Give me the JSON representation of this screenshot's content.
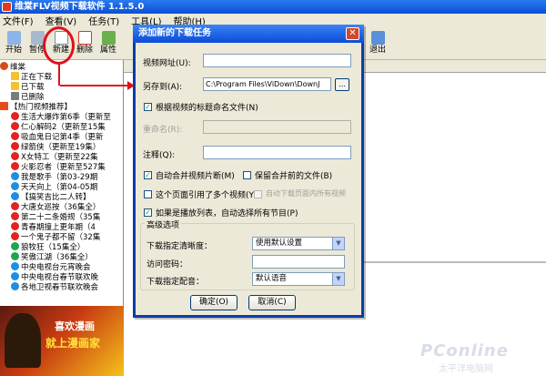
{
  "app": {
    "title": "维棠FLV视频下载软件 1.1.5.0",
    "menu": [
      "文件(F)",
      "查看(V)",
      "任务(T)",
      "工具(L)",
      "帮助(H)"
    ]
  },
  "toolbar": {
    "start": "开始",
    "pause": "暂停",
    "new": "新建",
    "delete": "删除",
    "properties": "属性",
    "exit": "退出"
  },
  "tree": {
    "root": "维棠",
    "downloading": "正在下载",
    "downloaded": "已下载",
    "deleted": "已删除",
    "hot_header": "【热门视频推荐】",
    "items": [
      "生活大爆炸第6季（更新至",
      "仁心解码2（更新至15集",
      "吸血鬼日记第4季（更新",
      "绿箭侠（更新至19集）",
      "X女特工（更新至22集",
      "火影忍者（更新至527集",
      "我是歌手（第03-29期",
      "天天向上（第04-05期",
      "【搞笑吉比二人转】",
      "大唐女巡按（36集全）",
      "第二十二条婚规（35集",
      "青春期撞上更年期（4",
      "一个鬼子都不留（32集",
      "狼牧狂（15集全）",
      "笑傲江湖（36集全）",
      "中央电视台元宵晚会",
      "中央电视台春节联欢晚",
      "各地卫视春节联欢晚会"
    ]
  },
  "banner": {
    "line1": "喜欢漫画",
    "line2": "就上漫画家"
  },
  "dialog": {
    "title": "添加新的下载任务",
    "url_label": "视频网址(U):",
    "url_value": "",
    "saveas_label": "另存到(A):",
    "saveas_value": "C:\\Program Files\\ViDown\\DownJ",
    "browse": "...",
    "rename_by_title": "根据视频的标题命名文件(N)",
    "rename_label": "重命名(R):",
    "rename_value": "",
    "note_label": "注释(Q):",
    "note_value": "",
    "auto_merge": "自动合并视频片断(M)",
    "keep_before_merge": "保留合并前的文件(B)",
    "multi_video": "这个页面引用了多个视频(Y)",
    "auto_download_all": "自动下载页面内所有视频",
    "playlist_auto": "如果是播放列表，自动选择所有节目(P)",
    "advanced_title": "高级选项",
    "clarity_label": "下载指定清晰度：",
    "clarity_value": "使用默认设置",
    "password_label": "访问密码：",
    "password_value": "",
    "dubbing_label": "下载指定配音：",
    "dubbing_value": "默认语音",
    "ok": "确定(O)",
    "cancel": "取消(C)"
  },
  "watermark": {
    "brand": "PConline",
    "sub": "太平洋电脑网"
  }
}
